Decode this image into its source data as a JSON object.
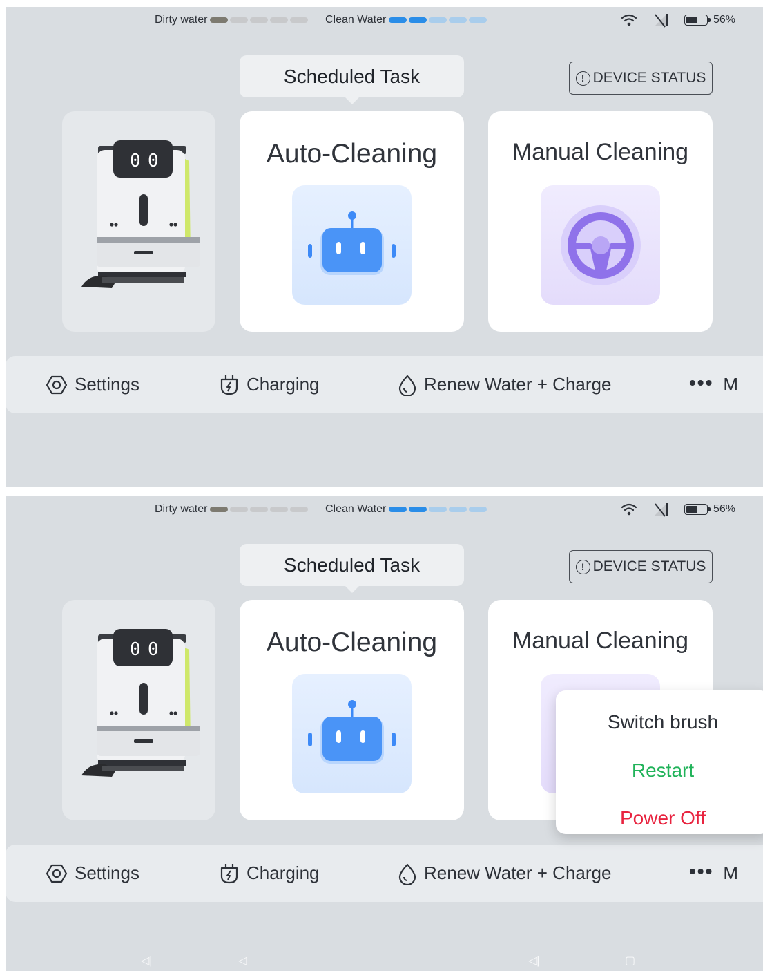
{
  "status_bar": {
    "dirty_water": {
      "label": "Dirty water",
      "level": 1,
      "segments": 5
    },
    "clean_water": {
      "label": "Clean Water",
      "level": 2,
      "segments": 5
    },
    "battery_percent": "56%",
    "battery_level": 0.56
  },
  "header": {
    "scheduled_task": "Scheduled Task",
    "device_status": "DEVICE STATUS"
  },
  "modes": {
    "auto": "Auto-Cleaning",
    "manual": "Manual Cleaning"
  },
  "nav": {
    "settings": "Settings",
    "charging": "Charging",
    "renew": "Renew Water + Charge",
    "more": "M"
  },
  "popup": {
    "switch_brush": "Switch brush",
    "restart": "Restart",
    "power_off": "Power Off"
  },
  "icons": {
    "settings": "hexagon-settings-icon",
    "charging": "battery-bolt-icon",
    "renew": "water-drop-icon",
    "more": "ellipsis-icon",
    "auto": "robot-head-icon",
    "manual": "steering-wheel-icon",
    "wifi": "wifi-icon",
    "signal": "no-signal-icon",
    "battery": "battery-icon"
  },
  "colors": {
    "dirty_fill": "#7d7a70",
    "clean_fill": "#2a8de8",
    "restart": "#21b35a",
    "power_off": "#e8233f"
  }
}
